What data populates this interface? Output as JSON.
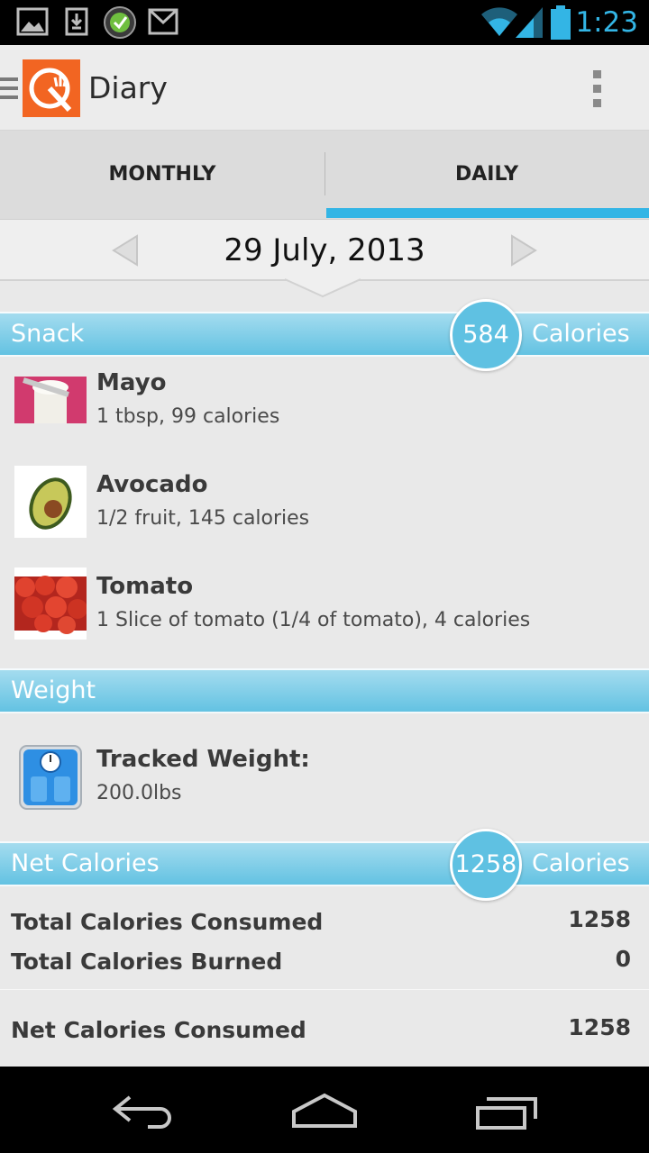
{
  "status_bar": {
    "time": "1:23",
    "icons": [
      "gallery-icon",
      "download-icon",
      "check-badge-icon",
      "gmail-icon",
      "wifi-icon",
      "signal-icon",
      "battery-icon"
    ]
  },
  "action_bar": {
    "title": "Diary",
    "icons": [
      "drawer-indicator-icon",
      "app-logo-icon",
      "overflow-menu-icon"
    ]
  },
  "tabs": [
    {
      "label": "MONTHLY",
      "selected": false
    },
    {
      "label": "DAILY",
      "selected": true
    }
  ],
  "date_nav": {
    "date": "29 July, 2013",
    "icons": [
      "previous-arrow-icon",
      "next-arrow-icon"
    ]
  },
  "snack": {
    "title": "Snack",
    "calories": "584",
    "unit": "Calories",
    "items": [
      {
        "name": "Mayo",
        "detail": "1 tbsp, 99 calories",
        "icon": "mayo-thumbnail"
      },
      {
        "name": "Avocado",
        "detail": "1/2 fruit, 145 calories",
        "icon": "avocado-thumbnail"
      },
      {
        "name": "Tomato",
        "detail": "1 Slice of tomato (1/4 of tomato), 4 calories",
        "icon": "tomato-thumbnail"
      }
    ]
  },
  "weight": {
    "title": "Weight",
    "label": "Tracked Weight:",
    "value": "200.0lbs",
    "icon": "scale-icon"
  },
  "net_calories": {
    "title": "Net Calories",
    "calories": "1258",
    "unit": "Calories",
    "rows": [
      {
        "label": "Total Calories Consumed",
        "value": "1258"
      },
      {
        "label": "Total Calories Burned",
        "value": "0"
      },
      {
        "label": "Net Calories Consumed",
        "value": "1258"
      }
    ]
  },
  "nav_bar": {
    "icons": [
      "back-icon",
      "home-icon",
      "recent-apps-icon"
    ]
  },
  "colors": {
    "accent": "#33b5e5",
    "section_header": "#63c2e2",
    "logo_orange": "#f26522",
    "status_bar": "#000000"
  }
}
